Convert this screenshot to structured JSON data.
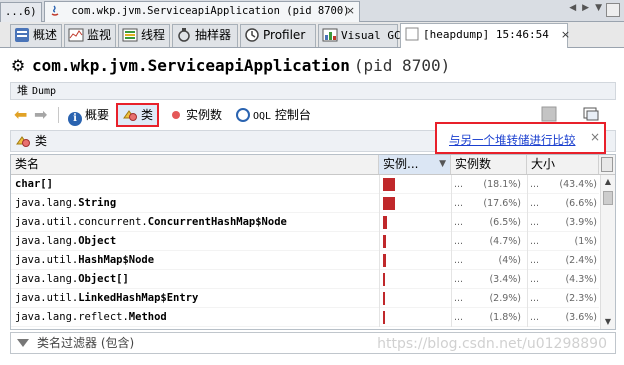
{
  "doc_tabs": {
    "overflow_label": "...6)",
    "app_tab_label": "com.wkp.jvm.ServiceapiApplication (pid 8700)",
    "close_glyph": "×"
  },
  "tool_tabs": [
    {
      "label": "概述",
      "icon": "info-icon"
    },
    {
      "label": "监视",
      "icon": "monitor-icon"
    },
    {
      "label": "线程",
      "icon": "threads-icon"
    },
    {
      "label": "抽样器",
      "icon": "sampler-icon"
    },
    {
      "label": "Profiler",
      "icon": "profiler-icon"
    },
    {
      "label": "Visual GC",
      "icon": "visualgc-icon"
    },
    {
      "label": "[heapdump] 15:46:54",
      "icon": "heapdump-icon",
      "active": true
    }
  ],
  "title": {
    "app": "com.wkp.jvm.ServiceapiApplication",
    "pid": "(pid 8700)"
  },
  "dump_bar": {
    "label": "堆",
    "sub": "Dump"
  },
  "toolbar": {
    "overview": "概要",
    "classes": "类",
    "instances": "实例数",
    "oql_prefix": "OQL",
    "oql": "控制台"
  },
  "class_header": {
    "label": "类"
  },
  "compare": {
    "link": "与另一个堆转储进行比较",
    "close": "×"
  },
  "table": {
    "columns": [
      "类名",
      "实例...",
      "实例数",
      "大小"
    ],
    "sort_glyph": "▼",
    "rows": [
      {
        "pkg": "",
        "cls": "char[]",
        "bar_pct": 18.1,
        "count_pct": "(18.1%)",
        "size_pct": "(43.4%)"
      },
      {
        "pkg": "java.lang.",
        "cls": "String",
        "bar_pct": 17.6,
        "count_pct": "(17.6%)",
        "size_pct": "(6.6%)"
      },
      {
        "pkg": "java.util.concurrent.",
        "cls": "ConcurrentHashMap$Node",
        "bar_pct": 6.5,
        "count_pct": "(6.5%)",
        "size_pct": "(3.9%)"
      },
      {
        "pkg": "java.lang.",
        "cls": "Object",
        "bar_pct": 4.7,
        "count_pct": "(4.7%)",
        "size_pct": "(1%)"
      },
      {
        "pkg": "java.util.",
        "cls": "HashMap$Node",
        "bar_pct": 4,
        "count_pct": "(4%)",
        "size_pct": "(2.4%)"
      },
      {
        "pkg": "java.lang.",
        "cls": "Object[]",
        "bar_pct": 3.4,
        "count_pct": "(3.4%)",
        "size_pct": "(4.3%)"
      },
      {
        "pkg": "java.util.",
        "cls": "LinkedHashMap$Entry",
        "bar_pct": 2.9,
        "count_pct": "(2.9%)",
        "size_pct": "(2.3%)"
      },
      {
        "pkg": "java.lang.reflect.",
        "cls": "Method",
        "bar_pct": 1.8,
        "count_pct": "(1.8%)",
        "size_pct": "(3.6%)"
      }
    ],
    "ellipsis": "..."
  },
  "filter": {
    "placeholder": "类名过滤器 (包含)"
  },
  "watermark": "https://blog.csdn.net/u01298890",
  "colors": {
    "highlight_border": "#e8202a",
    "bar": "#c0282b",
    "link": "#1a3fcf"
  }
}
